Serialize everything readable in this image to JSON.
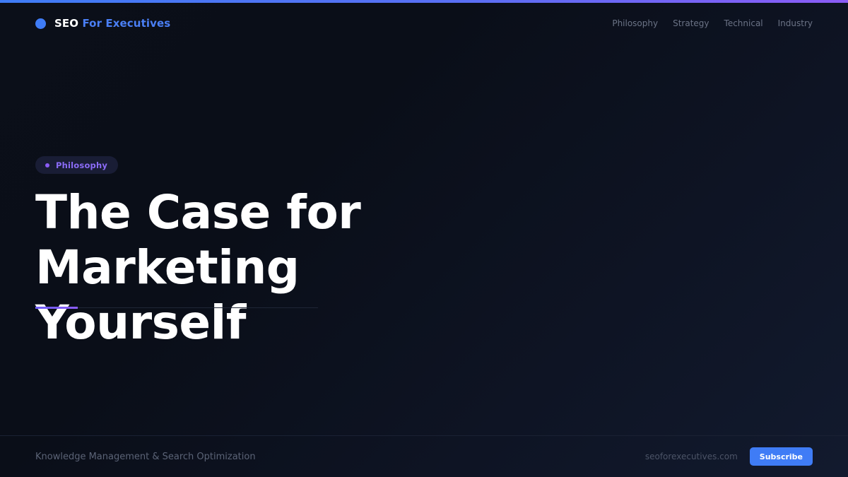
{
  "brand": {
    "name_primary": "SEO",
    "name_secondary": "For Executives"
  },
  "nav": {
    "items": [
      "Philosophy",
      "Strategy",
      "Technical",
      "Industry"
    ]
  },
  "hero": {
    "category": "Philosophy",
    "title_line1": "The Case for Marketing",
    "title_line2": "Yourself"
  },
  "footer": {
    "tagline": "Knowledge Management & Search Optimization",
    "domain": "seoforexecutives.com",
    "subscribe_label": "Subscribe"
  },
  "colors": {
    "background": "#0b0f1a",
    "accent_blue": "#3f7cf6",
    "accent_purple": "#8b5cf6",
    "text_primary": "#ffffff",
    "text_muted": "#6b7386"
  }
}
